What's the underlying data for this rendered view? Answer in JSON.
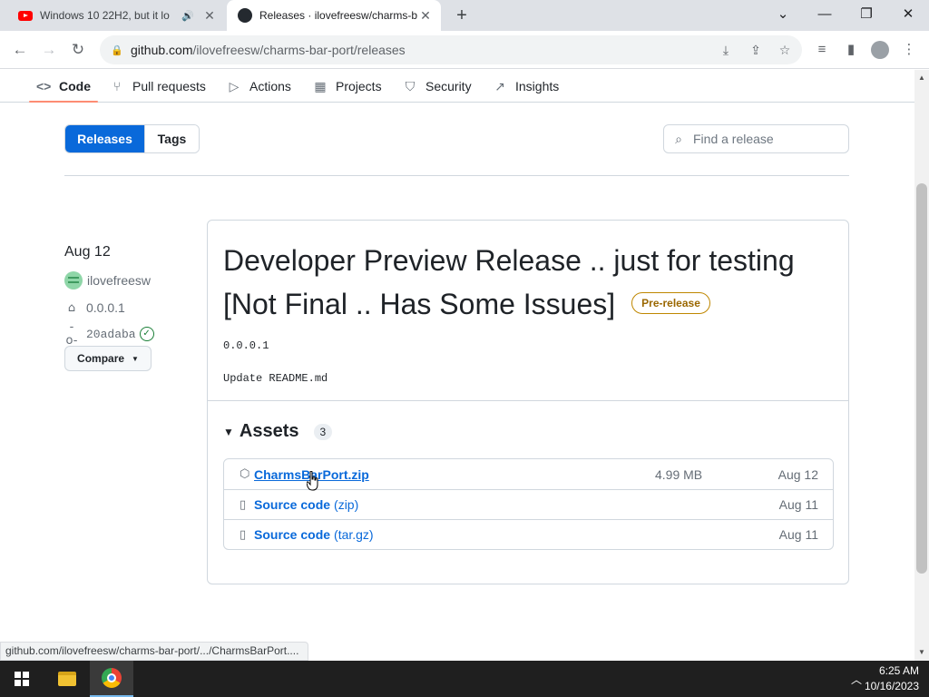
{
  "browser": {
    "tabs": [
      {
        "title": "Windows 10 22H2, but it lo",
        "favicon": "youtube-icon"
      },
      {
        "title": "Releases · ilovefreesw/charms-b",
        "favicon": "github-icon"
      }
    ],
    "url_host": "github.com",
    "url_path": "/ilovefreesw/charms-bar-port/releases"
  },
  "repo_nav": {
    "tabs": [
      {
        "label": "Code",
        "icon": "code-icon"
      },
      {
        "label": "Pull requests",
        "icon": "pull-request-icon"
      },
      {
        "label": "Actions",
        "icon": "play-icon"
      },
      {
        "label": "Projects",
        "icon": "table-icon"
      },
      {
        "label": "Security",
        "icon": "shield-icon"
      },
      {
        "label": "Insights",
        "icon": "graph-icon"
      }
    ]
  },
  "filter": {
    "releases_label": "Releases",
    "tags_label": "Tags",
    "search_placeholder": "Find a release"
  },
  "release": {
    "date": "Aug 12",
    "author": "ilovefreesw",
    "tag": "0.0.0.1",
    "commit": "20adaba",
    "compare_label": "Compare",
    "title": "Developer Preview Release .. just for testing [Not Final .. Has Some Issues]",
    "badge": "Pre-release",
    "tag_text": "0.0.0.1",
    "body": "Update README.md",
    "assets_title": "Assets",
    "assets_count": "3",
    "assets": [
      {
        "name": "CharmsBarPort.zip",
        "suffix": "",
        "size": "4.99 MB",
        "date": "Aug 12",
        "icon": "package-icon"
      },
      {
        "name": "Source code",
        "suffix": "(zip)",
        "size": "",
        "date": "Aug 11",
        "icon": "file-zip-icon"
      },
      {
        "name": "Source code",
        "suffix": "(tar.gz)",
        "size": "",
        "date": "Aug 11",
        "icon": "file-zip-icon"
      }
    ]
  },
  "status_link": "github.com/ilovefreesw/charms-bar-port/.../CharmsBarPort....",
  "taskbar": {
    "time": "6:25 AM",
    "date": "10/16/2023"
  },
  "colors": {
    "accent": "#0969da",
    "prerelease": "#9a6700",
    "selected_tab_underline": "#fd8c73"
  }
}
